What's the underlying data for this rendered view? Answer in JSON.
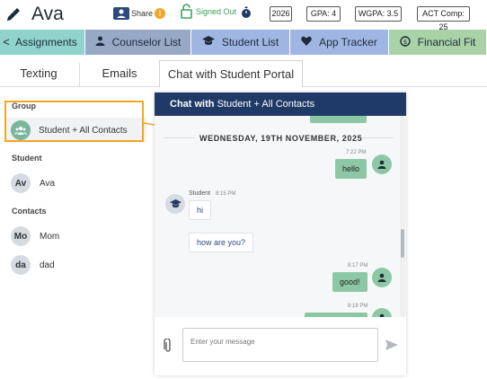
{
  "header": {
    "student_name": "Ava",
    "share_label": "Share",
    "share_badge": "!",
    "signed_out_label": "Signed Out",
    "grad_year": "2026",
    "gpa": "GPA: 4",
    "wgpa": "WGPA: 3.5",
    "act": "ACT Comp: 25"
  },
  "nav": {
    "prev_arrow": "<",
    "tabs": [
      {
        "label": "Assignments",
        "color": "#8fd3cc"
      },
      {
        "label": "Counselor List",
        "color": "#98a9c6"
      },
      {
        "label": "Student List",
        "color": "#9fb6e3"
      },
      {
        "label": "App Tracker",
        "color": "#9fb6e3"
      },
      {
        "label": "Financial Fit",
        "color": "#a9d3a6"
      }
    ]
  },
  "subtabs": [
    {
      "label": "Texting"
    },
    {
      "label": "Emails"
    },
    {
      "label": "Chat with Student Portal"
    }
  ],
  "left_panel": {
    "group_label": "Group",
    "group_name": "Student + All Contacts",
    "student_label": "Student",
    "student": {
      "initials": "Av",
      "name": "Ava"
    },
    "contacts_label": "Contacts",
    "contacts": [
      {
        "initials": "Mo",
        "name": "Mom"
      },
      {
        "initials": "da",
        "name": "dad"
      }
    ]
  },
  "chat": {
    "header_prefix": "Chat with",
    "header_target": "Student + All Contacts",
    "date_separator": "WEDNESDAY, 19TH NOVEMBER, 2025",
    "messages": [
      {
        "dir": "out",
        "time": "7:22 PM",
        "text": "hello"
      },
      {
        "dir": "in",
        "sender": "Student",
        "time": "8:15 PM",
        "text": "hi"
      },
      {
        "dir": "in",
        "text": "how are you?"
      },
      {
        "dir": "out",
        "time": "8:17 PM",
        "text": "good!"
      },
      {
        "dir": "out",
        "time": "8:18 PM",
        "text": ""
      }
    ],
    "input_placeholder": "Enter your message"
  },
  "colors": {
    "chat_header": "#1f3a66",
    "outgoing_bubble": "#8dc8a6",
    "highlight": "#f5a623",
    "signed_out": "#3aa35b"
  },
  "icons": [
    "edit-icon",
    "share-icon",
    "lock-icon",
    "timer-icon",
    "user-icon",
    "graduation-cap-icon",
    "heart-icon",
    "dollar-cycle-icon",
    "group-icon",
    "paperclip-icon",
    "send-icon"
  ]
}
